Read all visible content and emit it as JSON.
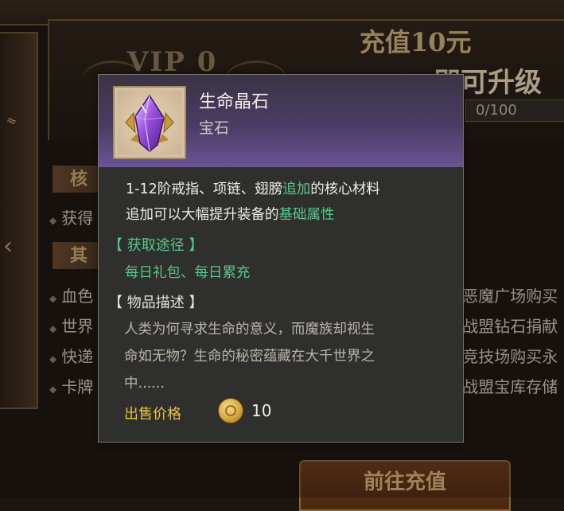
{
  "background": {
    "vip_label": "VIP 0",
    "recharge_title": "充值10元",
    "upgrade_text": "即可升级为",
    "progress": "0/100",
    "section_tab_1": "核",
    "section_tab_2": "其",
    "left_lines": [
      "获得",
      "血色",
      "世界",
      "快递",
      "卡牌"
    ],
    "right_lines": [
      "恶魔广场购买",
      "战盟钻石捐献",
      "竞技场购买永",
      "战盟宝库存储"
    ],
    "go_recharge_button": "前往充值"
  },
  "tooltip": {
    "item_name": "生命晶石",
    "item_type": "宝石",
    "description": {
      "line1_a": "1-12阶戒指、项链、翅膀",
      "line1_highlight": "追加",
      "line1_b": "的核心材料",
      "line2_a": "追加可以大幅提升装备的",
      "line2_highlight": "基础属性"
    },
    "source_heading": "【 获取途径 】",
    "source_text": "每日礼包、每日累充",
    "lore_heading": "【 物品描述 】",
    "lore_lines": [
      "人类为何寻求生命的意义，而魔族却视生",
      "命如无物？生命的秘密蕴藏在大千世界之",
      "中......"
    ],
    "sell_label": "出售价格",
    "sell_value": "10",
    "sell_currency_icon": "gold-coin-icon"
  },
  "colors": {
    "highlight_green": "#58c78a",
    "price_gold": "#e8c24a",
    "header_purple": "#6a5494"
  }
}
